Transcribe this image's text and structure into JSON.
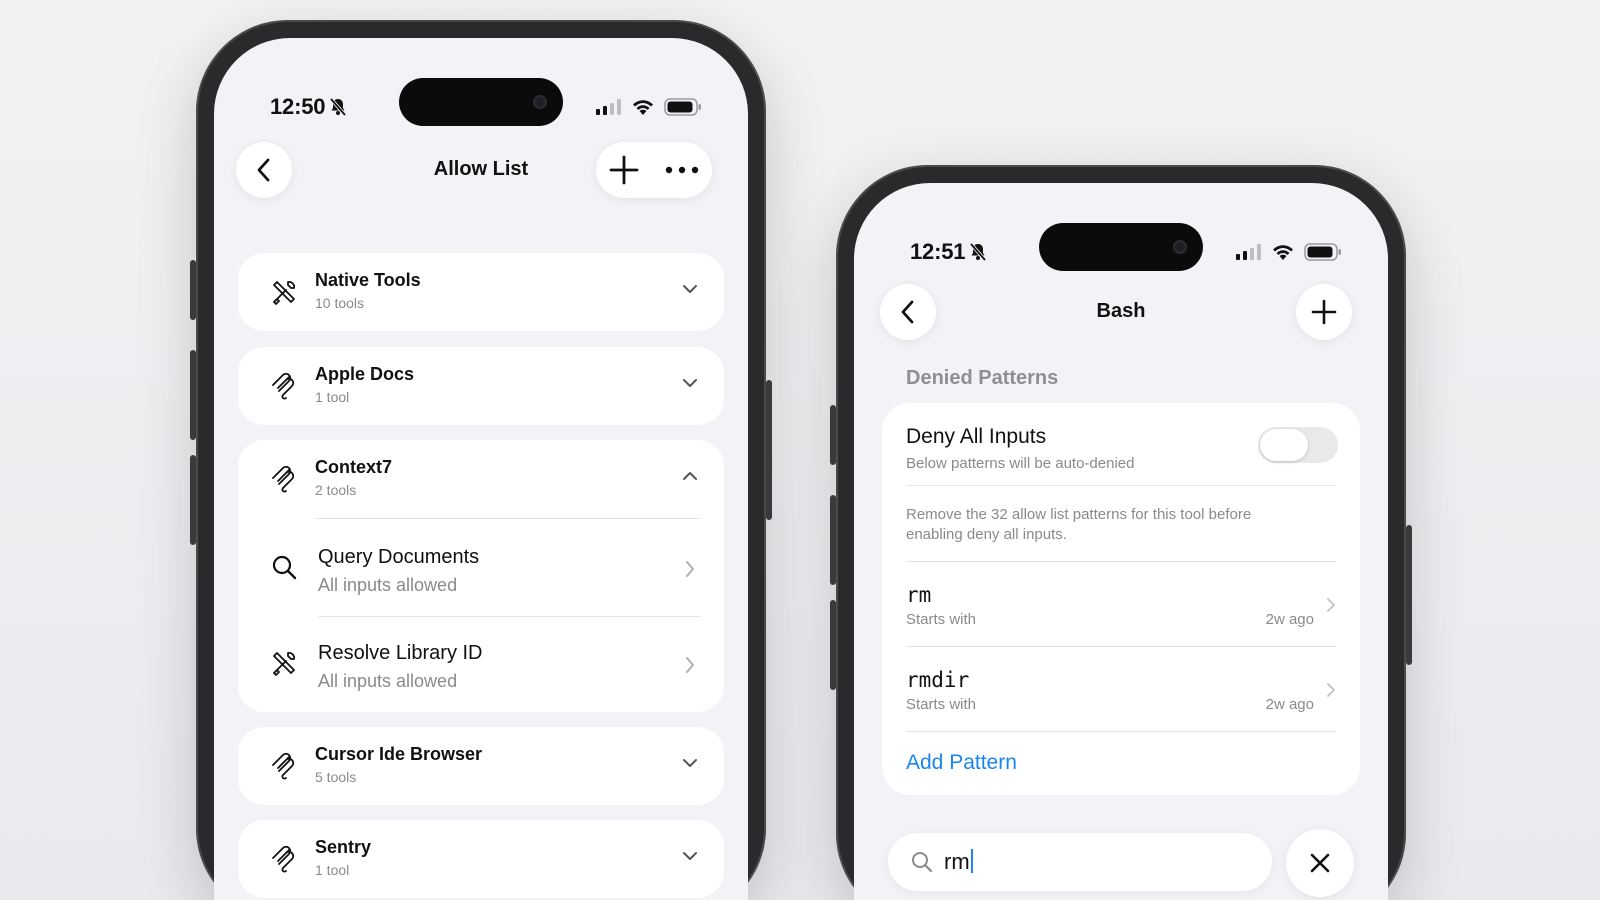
{
  "left_phone": {
    "status": {
      "time": "12:50"
    },
    "title": "Allow List",
    "groups": [
      {
        "name": "Native Tools",
        "count": "10 tools"
      },
      {
        "name": "Apple Docs",
        "count": "1 tool"
      },
      {
        "name": "Context7",
        "count": "2 tools",
        "items": [
          {
            "name": "Query Documents",
            "subtitle": "All inputs allowed"
          },
          {
            "name": "Resolve Library ID",
            "subtitle": "All inputs allowed"
          }
        ]
      },
      {
        "name": "Cursor Ide Browser",
        "count": "5 tools"
      },
      {
        "name": "Sentry",
        "count": "1 tool"
      }
    ]
  },
  "right_phone": {
    "status": {
      "time": "12:51"
    },
    "title": "Bash",
    "section_header": "Denied Patterns",
    "deny_all": {
      "label": "Deny All Inputs",
      "subtitle": "Below patterns will be auto-denied",
      "enabled": false,
      "note": "Remove the 32 allow list patterns for this tool before enabling deny all inputs."
    },
    "patterns": [
      {
        "pattern": "rm",
        "match": "Starts with",
        "age": "2w ago"
      },
      {
        "pattern": "rmdir",
        "match": "Starts with",
        "age": "2w ago"
      }
    ],
    "add_pattern_label": "Add Pattern",
    "search_value": "rm"
  },
  "colors": {
    "accent": "#1a86f0",
    "background": "#f2f2f7",
    "card": "#ffffff",
    "secondary_text": "#8a8a8e"
  }
}
